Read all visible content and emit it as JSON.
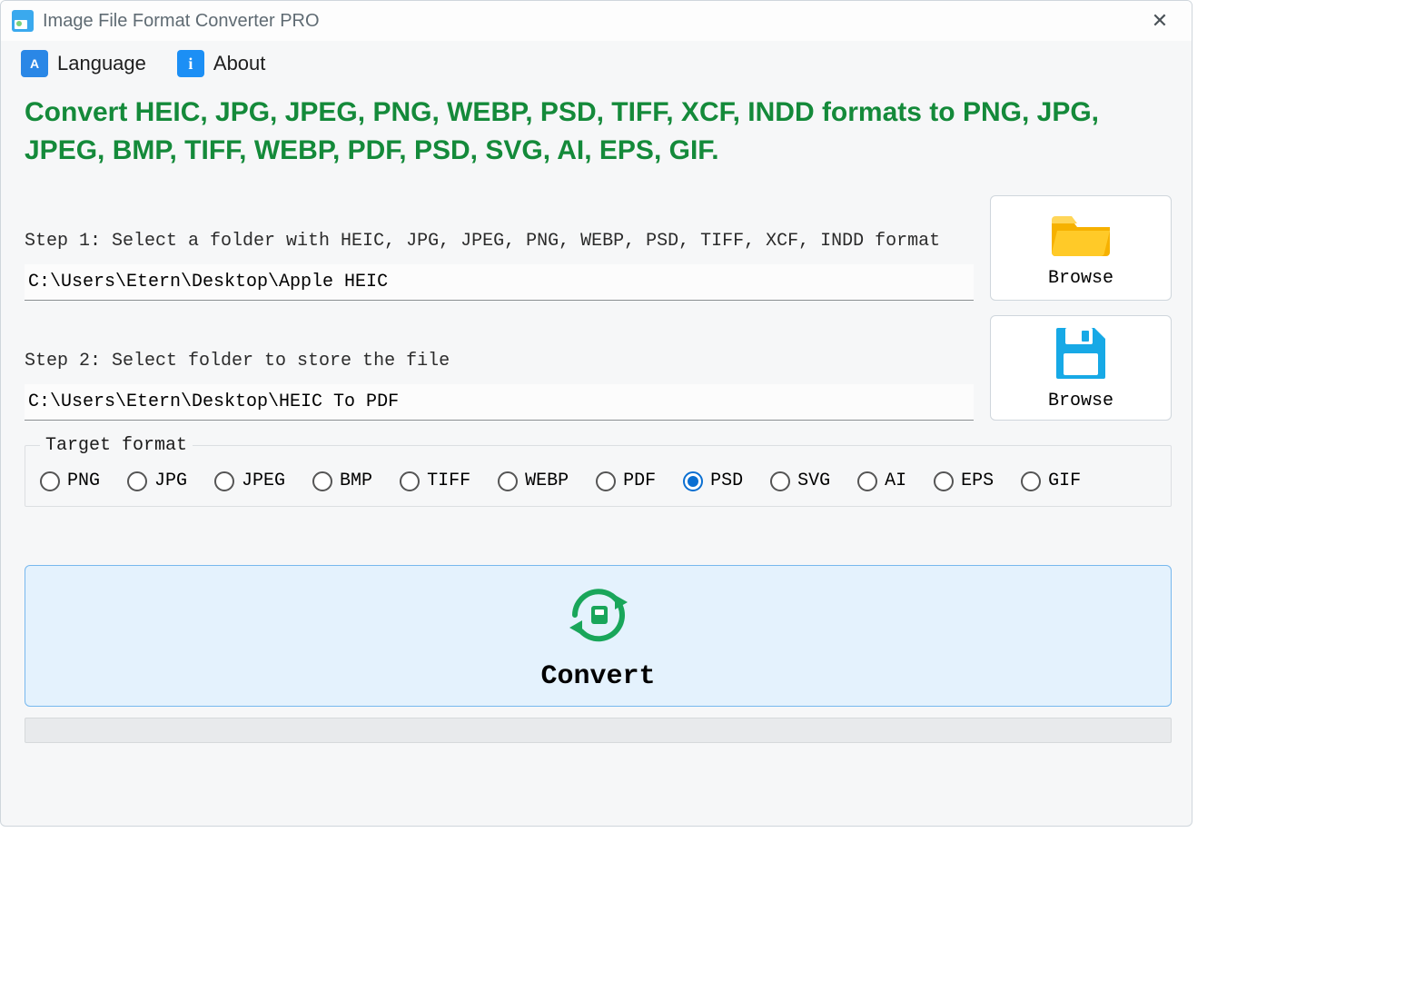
{
  "window": {
    "title": "Image File Format Converter PRO"
  },
  "menu": {
    "language_label": "Language",
    "about_label": "About"
  },
  "headline": "Convert HEIC, JPG, JPEG, PNG, WEBP, PSD, TIFF, XCF, INDD formats to PNG, JPG, JPEG, BMP, TIFF, WEBP, PDF, PSD, SVG, AI, EPS, GIF.",
  "step1": {
    "label": "Step 1: Select a folder with HEIC, JPG, JPEG, PNG, WEBP, PSD, TIFF, XCF, INDD format",
    "value": "C:\\Users\\Etern\\Desktop\\Apple HEIC",
    "browse_label": "Browse"
  },
  "step2": {
    "label": "Step 2: Select folder to store the file",
    "value": "C:\\Users\\Etern\\Desktop\\HEIC To PDF",
    "browse_label": "Browse"
  },
  "target": {
    "legend": "Target format",
    "selected": "PSD",
    "options": [
      "PNG",
      "JPG",
      "JPEG",
      "BMP",
      "TIFF",
      "WEBP",
      "PDF",
      "PSD",
      "SVG",
      "AI",
      "EPS",
      "GIF"
    ]
  },
  "convert_label": "Convert"
}
